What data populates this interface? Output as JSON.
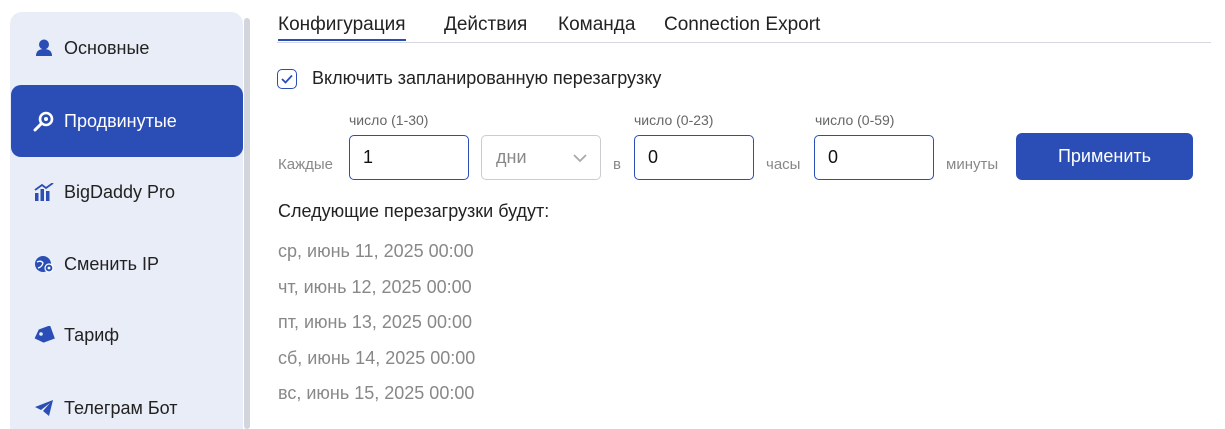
{
  "sidebar": {
    "items": [
      {
        "label": "Основные",
        "icon": "user-icon",
        "active": false
      },
      {
        "label": "Продвинутые",
        "icon": "key-gear-icon",
        "active": true
      },
      {
        "label": "BigDaddy Pro",
        "icon": "bar-chart-icon",
        "active": false
      },
      {
        "label": "Сменить IP",
        "icon": "globe-pin-icon",
        "active": false
      },
      {
        "label": "Тариф",
        "icon": "tag-icon",
        "active": false
      },
      {
        "label": "Телеграм Бот",
        "icon": "telegram-icon",
        "active": false
      }
    ]
  },
  "tabs": [
    {
      "label": "Конфигурация",
      "active": true
    },
    {
      "label": "Действия",
      "active": false
    },
    {
      "label": "Команда",
      "active": false
    },
    {
      "label": "Connection Export",
      "active": false
    }
  ],
  "schedule": {
    "enable_label": "Включить запланированную перезагрузку",
    "enabled": true,
    "every_label": "Каждые",
    "number_hint": "число (1-30)",
    "number_value": "1",
    "unit_value": "дни",
    "at_label": "в",
    "hours_hint": "число (0-23)",
    "hours_value": "0",
    "hours_label": "часы",
    "minutes_hint": "число (0-59)",
    "minutes_value": "0",
    "minutes_label": "минуты",
    "apply_label": "Применить"
  },
  "next_reboots": {
    "title": "Следующие перезагрузки будут:",
    "items": [
      "ср, июнь 11, 2025 00:00",
      "чт, июнь 12, 2025 00:00",
      "пт, июнь 13, 2025 00:00",
      "сб, июнь 14, 2025 00:00",
      "вс, июнь 15, 2025 00:00"
    ]
  },
  "colors": {
    "accent": "#2a4eb5",
    "sidebar_bg": "#e9edf7",
    "muted_text": "#888888"
  }
}
